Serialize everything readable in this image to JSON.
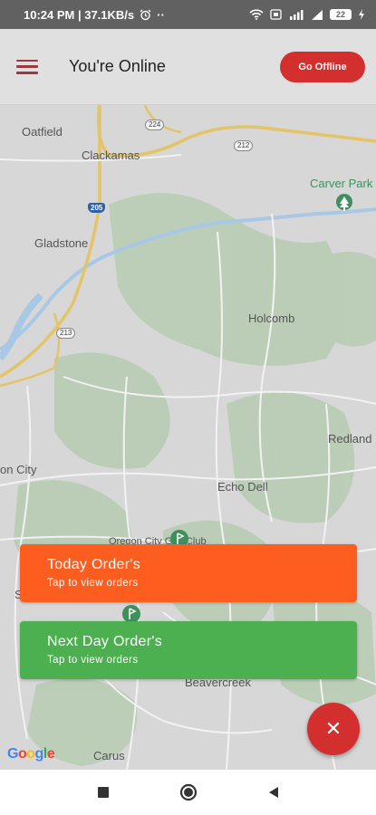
{
  "status_bar": {
    "time_speed": "10:24 PM | 37.1KB/s",
    "battery": "22"
  },
  "app_bar": {
    "title": "You're Online",
    "go_offline_label": "Go Offline",
    "menu_icon": "hamburger-menu-icon"
  },
  "map": {
    "labels": {
      "oatfield": "Oatfield",
      "clackamas": "Clackamas",
      "carver_park": "Carver Park",
      "gladstone": "Gladstone",
      "holcomb": "Holcomb",
      "redland": "Redland",
      "on_city": "on City",
      "echo_dell": "Echo Dell",
      "beavercreek": "Beavercreek",
      "carus": "Carus",
      "s_fragment": "S",
      "oregon_city_golf": "Oregon City Golf Club"
    },
    "shields": {
      "r224": "224",
      "r212": "212",
      "i205": "205",
      "r213": "213"
    },
    "google": "Google"
  },
  "orders": {
    "today": {
      "title": "Today Order's",
      "subtitle": "Tap to view orders"
    },
    "next_day": {
      "title": "Next Day Order's",
      "subtitle": "Tap to view orders"
    }
  },
  "fab": {
    "label": "✕"
  },
  "colors": {
    "accent": "#d32f2f",
    "today": "#fd5d1f",
    "next_day": "#4caf50"
  }
}
